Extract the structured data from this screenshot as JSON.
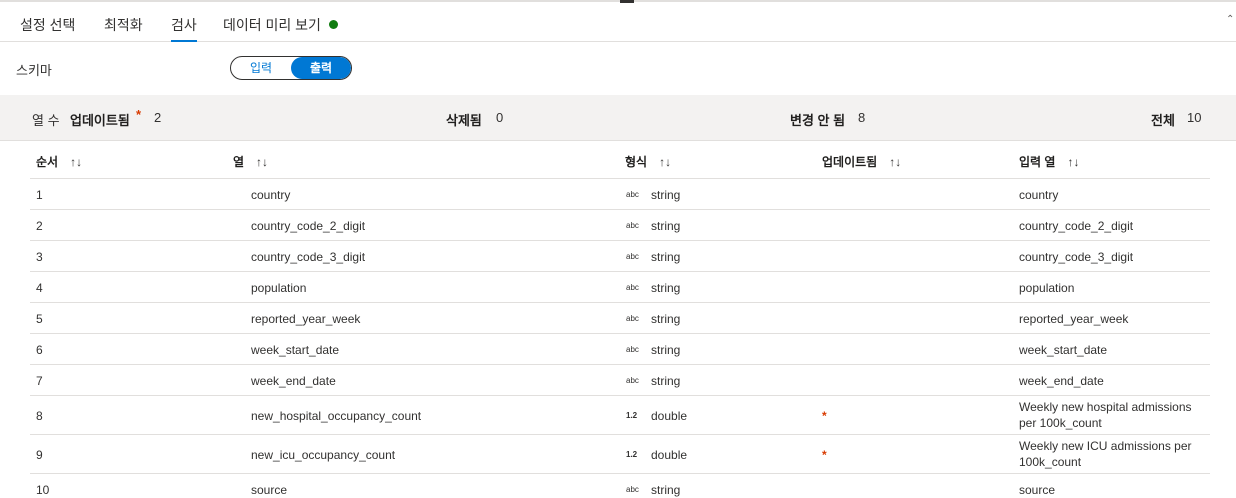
{
  "tabs": [
    {
      "label": "설정 선택"
    },
    {
      "label": "최적화"
    },
    {
      "label": "검사"
    },
    {
      "label": "데이터 미리 보기"
    }
  ],
  "schema": {
    "label": "스키마",
    "toggle_input": "입력",
    "toggle_output": "출력",
    "selected": "출력"
  },
  "summary": {
    "columns_label": "열 수",
    "updated_label": "업데이트됨",
    "updated_asterisk": "*",
    "updated_count": "2",
    "deleted_label": "삭제됨",
    "deleted_count": "0",
    "unchanged_label": "변경 안 됨",
    "unchanged_count": "8",
    "total_label": "전체",
    "total_count": "10"
  },
  "table": {
    "headers": {
      "order": "순서",
      "column": "열",
      "type": "형식",
      "updated": "업데이트됨",
      "input_column": "입력 열",
      "sort_glyph": "↑↓"
    },
    "rows": [
      {
        "order": "1",
        "column": "country",
        "type_icon": "abc",
        "type": "string",
        "updated": "",
        "input": "country"
      },
      {
        "order": "2",
        "column": "country_code_2_digit",
        "type_icon": "abc",
        "type": "string",
        "updated": "",
        "input": "country_code_2_digit"
      },
      {
        "order": "3",
        "column": "country_code_3_digit",
        "type_icon": "abc",
        "type": "string",
        "updated": "",
        "input": "country_code_3_digit"
      },
      {
        "order": "4",
        "column": "population",
        "type_icon": "abc",
        "type": "string",
        "updated": "",
        "input": "population"
      },
      {
        "order": "5",
        "column": "reported_year_week",
        "type_icon": "abc",
        "type": "string",
        "updated": "",
        "input": "reported_year_week"
      },
      {
        "order": "6",
        "column": "week_start_date",
        "type_icon": "abc",
        "type": "string",
        "updated": "",
        "input": "week_start_date"
      },
      {
        "order": "7",
        "column": "week_end_date",
        "type_icon": "abc",
        "type": "string",
        "updated": "",
        "input": "week_end_date"
      },
      {
        "order": "8",
        "column": "new_hospital_occupancy_count",
        "type_icon": "1.2",
        "type": "double",
        "updated": "*",
        "input": "Weekly new hospital admissions per 100k_count"
      },
      {
        "order": "9",
        "column": "new_icu_occupancy_count",
        "type_icon": "1.2",
        "type": "double",
        "updated": "*",
        "input": "Weekly new ICU admissions per 100k_count"
      },
      {
        "order": "10",
        "column": "source",
        "type_icon": "abc",
        "type": "string",
        "updated": "",
        "input": "source"
      }
    ]
  },
  "colors": {
    "accent": "#0078d4",
    "status_green": "#107c10",
    "asterisk": "#d83b01"
  }
}
